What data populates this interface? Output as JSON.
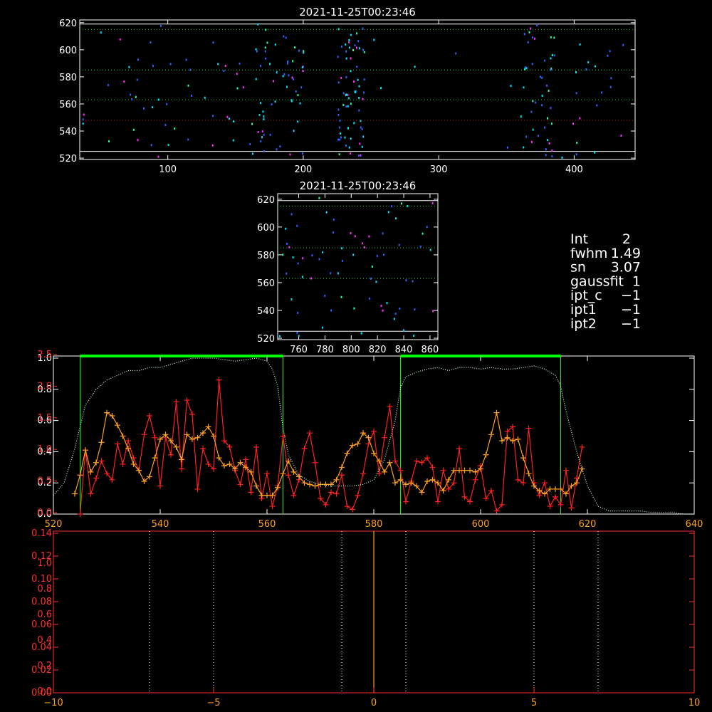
{
  "colors": {
    "white": "#ffffff",
    "red": "#ff2020",
    "orange": "#ffa020",
    "green": "#00ff00",
    "light_green": "#d0ffd0",
    "red_axis": "#ff3030",
    "cyan": "#00e0ff",
    "blue": "#3060ff",
    "magenta": "#ff30ff",
    "teal": "#20ffb0"
  },
  "info_panel": [
    {
      "label": "Int",
      "value": "2"
    },
    {
      "label": "fwhm",
      "value": "1.49"
    },
    {
      "label": "sn",
      "value": "3.07"
    },
    {
      "label": "gaussfit",
      "value": "1"
    },
    {
      "label": "ipt_c",
      "value": "−1"
    },
    {
      "label": "ipt1",
      "value": "−1"
    },
    {
      "label": "ipt2",
      "value": "−1"
    }
  ],
  "chart_data": [
    {
      "id": "image_full",
      "type": "scatter",
      "title": "2021-11-25T00:23:46",
      "xlim": [
        35,
        445
      ],
      "ylim": [
        519,
        622
      ],
      "x_ticks": [
        100,
        200,
        300,
        400
      ],
      "y_ticks": [
        520,
        540,
        560,
        580,
        600,
        620
      ],
      "solid_lines_y": [
        525,
        619
      ],
      "dotted_green_y": [
        563,
        585,
        615
      ],
      "dotted_red_y": [
        548
      ]
    },
    {
      "id": "image_zoom",
      "type": "scatter",
      "title": "2021-11-25T00:23:46",
      "xlim": [
        744,
        866
      ],
      "ylim": [
        519,
        624
      ],
      "x_ticks": [
        760,
        780,
        800,
        820,
        840,
        860
      ],
      "y_ticks": [
        520,
        540,
        560,
        580,
        600,
        620
      ],
      "solid_lines_y": [
        525,
        619
      ],
      "dotted_green_y": [
        563,
        585,
        615
      ],
      "dotted_red_y": []
    },
    {
      "id": "spectrum",
      "type": "line",
      "xlim": [
        520,
        640
      ],
      "x_ticks": [
        520,
        540,
        560,
        580,
        600,
        620,
        640
      ],
      "left_white_ticks": [
        "0.0",
        "0.2",
        "0.4",
        "0.6",
        "0.8",
        "1.0"
      ],
      "left_red_ticks": [
        "0.0",
        "0.5",
        "1.0",
        "1.5",
        "2.0",
        "2.5"
      ],
      "ylim": [
        0,
        1
      ],
      "window_ranges": [
        [
          525,
          563
        ],
        [
          585,
          615
        ]
      ],
      "series": [
        {
          "color": "red",
          "x": [
            525,
            526,
            527,
            528,
            529,
            530,
            531,
            532,
            533,
            534,
            535,
            536,
            537,
            538,
            539,
            540,
            541,
            542,
            543,
            544,
            545,
            546,
            547,
            548,
            549,
            550,
            551,
            552,
            553,
            554,
            555,
            556,
            557,
            558,
            559,
            560,
            561,
            562,
            563,
            564,
            565,
            566,
            567,
            568,
            569,
            570,
            571,
            572,
            573,
            574,
            575,
            576,
            577,
            578,
            579,
            580,
            581,
            582,
            583,
            584,
            585,
            586,
            587,
            588,
            589,
            590,
            591,
            592,
            593,
            594,
            595,
            596,
            597,
            598,
            599,
            600,
            601,
            602,
            603,
            604,
            605,
            606,
            607,
            608,
            609,
            610,
            611,
            612,
            613,
            614,
            615,
            616,
            617,
            618,
            619
          ],
          "y": [
            0.0,
            0.41,
            0.13,
            0.23,
            0.34,
            0.26,
            0.22,
            0.45,
            0.32,
            0.47,
            0.36,
            0.28,
            0.51,
            0.63,
            0.49,
            0.18,
            0.49,
            0.38,
            0.72,
            0.29,
            0.73,
            0.64,
            0.16,
            0.42,
            0.32,
            0.29,
            0.86,
            0.47,
            0.43,
            0.28,
            0.19,
            0.35,
            0.14,
            0.43,
            0.1,
            0.26,
            0.05,
            0.18,
            0.5,
            0.25,
            0.12,
            0.22,
            0.42,
            0.52,
            0.33,
            0.1,
            0.06,
            0.14,
            0.13,
            0.25,
            0.05,
            0.03,
            0.12,
            0.26,
            0.45,
            0.53,
            0.26,
            0.49,
            0.69,
            0.34,
            0.28,
            0.08,
            0.21,
            0.34,
            0.33,
            0.36,
            0.3,
            0.08,
            0.28,
            0.16,
            0.2,
            0.42,
            0.11,
            0.08,
            0.22,
            0.31,
            0.1,
            0.15,
            0.02,
            0.06,
            0.53,
            0.56,
            0.22,
            0.2,
            0.55,
            0.2,
            0.12,
            0.2,
            0.05,
            0.11,
            0.06,
            0.28,
            0.04,
            0.23,
            0.43
          ]
        },
        {
          "color": "orange",
          "x": [
            524,
            525,
            526,
            527,
            528,
            529,
            530,
            531,
            532,
            533,
            534,
            535,
            536,
            537,
            538,
            539,
            540,
            541,
            542,
            543,
            544,
            545,
            546,
            547,
            548,
            549,
            550,
            551,
            552,
            553,
            554,
            555,
            556,
            557,
            558,
            559,
            560,
            561,
            562,
            563,
            564,
            565,
            566,
            567,
            568,
            569,
            570,
            571,
            572,
            573,
            574,
            575,
            576,
            577,
            578,
            579,
            580,
            581,
            582,
            583,
            584,
            585,
            586,
            587,
            588,
            589,
            590,
            591,
            592,
            593,
            594,
            595,
            596,
            597,
            598,
            599,
            600,
            601,
            602,
            603,
            604,
            605,
            606,
            607,
            608,
            609,
            610,
            611,
            612,
            613,
            614,
            615,
            616,
            617,
            618,
            619
          ],
          "y": [
            0.13,
            0.25,
            0.41,
            0.27,
            0.33,
            0.46,
            0.65,
            0.63,
            0.57,
            0.5,
            0.42,
            0.32,
            0.28,
            0.21,
            0.24,
            0.36,
            0.48,
            0.51,
            0.47,
            0.43,
            0.35,
            0.51,
            0.48,
            0.49,
            0.52,
            0.56,
            0.5,
            0.36,
            0.31,
            0.32,
            0.29,
            0.33,
            0.3,
            0.27,
            0.18,
            0.12,
            0.12,
            0.12,
            0.17,
            0.26,
            0.34,
            0.27,
            0.24,
            0.2,
            0.19,
            0.18,
            0.19,
            0.19,
            0.19,
            0.22,
            0.3,
            0.39,
            0.44,
            0.45,
            0.52,
            0.49,
            0.39,
            0.34,
            0.27,
            0.33,
            0.2,
            0.22,
            0.19,
            0.2,
            0.18,
            0.14,
            0.21,
            0.22,
            0.2,
            0.15,
            0.22,
            0.28,
            0.28,
            0.28,
            0.28,
            0.27,
            0.29,
            0.38,
            0.51,
            0.65,
            0.47,
            0.49,
            0.47,
            0.48,
            0.36,
            0.26,
            0.18,
            0.15,
            0.13,
            0.16,
            0.16,
            0.16,
            0.13,
            0.18,
            0.2,
            0.29
          ]
        },
        {
          "color": "light_green",
          "style": "dotted",
          "x": [
            520,
            522,
            524,
            526,
            528,
            530,
            532,
            534,
            536,
            538,
            540,
            542,
            544,
            546,
            548,
            550,
            552,
            554,
            556,
            558,
            560,
            561,
            562,
            563,
            564,
            566,
            568,
            570,
            572,
            574,
            576,
            578,
            580,
            582,
            584,
            585,
            586,
            588,
            590,
            592,
            594,
            596,
            598,
            600,
            602,
            604,
            606,
            608,
            610,
            612,
            614,
            615,
            616,
            618,
            620,
            622,
            624,
            626,
            628,
            630,
            632,
            634,
            636,
            638,
            640
          ],
          "y": [
            0.12,
            0.2,
            0.42,
            0.7,
            0.8,
            0.86,
            0.89,
            0.92,
            0.92,
            0.94,
            0.94,
            0.96,
            0.98,
            1.0,
            1.0,
            1.0,
            0.99,
            0.98,
            0.99,
            1.0,
            0.98,
            0.93,
            0.82,
            0.55,
            0.38,
            0.25,
            0.21,
            0.19,
            0.18,
            0.18,
            0.18,
            0.19,
            0.22,
            0.35,
            0.6,
            0.81,
            0.88,
            0.91,
            0.93,
            0.94,
            0.92,
            0.94,
            0.94,
            0.93,
            0.94,
            0.93,
            0.93,
            0.94,
            0.95,
            0.93,
            0.89,
            0.82,
            0.66,
            0.4,
            0.18,
            0.05,
            0.02,
            0.02,
            0.02,
            0.02,
            0.01,
            0.01,
            0.01,
            0.0,
            0.0
          ]
        }
      ]
    },
    {
      "id": "fit_panel",
      "type": "line",
      "xlim": [
        -10,
        10
      ],
      "x_ticks": [
        -10,
        -5,
        0,
        5,
        10
      ],
      "left_white_ticks": [
        "0.00",
        "0.02",
        "0.04",
        "0.06",
        "0.08",
        "0.10",
        "0.12",
        "0.14"
      ],
      "left_red_ticks": [
        "0.0",
        "0.2",
        "0.4",
        "0.6",
        "0.8",
        "1.0"
      ],
      "dotted_white_x": [
        -7,
        -5,
        -1,
        1,
        5,
        7
      ],
      "orange_line_x": 0
    }
  ]
}
